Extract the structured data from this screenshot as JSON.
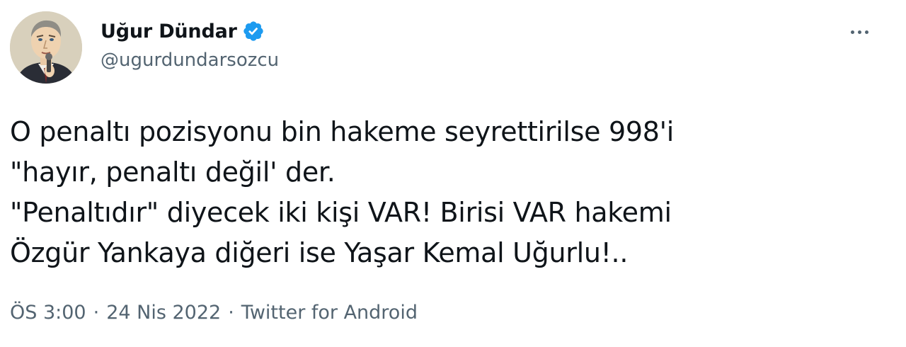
{
  "author": {
    "display_name": "Uğur Dündar",
    "handle": "@ugurdundarsozcu",
    "verified": true,
    "avatar_icon": "profile-portrait-avatar",
    "verified_icon": "verified-badge-icon"
  },
  "more_icon": "more-options-icon",
  "tweet": {
    "lines": [
      "O penaltı pozisyonu bin hakeme seyrettirilse 998'i",
      "\"hayır, penaltı değil' der.",
      "\"Penaltıdır\" diyecek iki kişi VAR! Birisi VAR hakemi",
      "Özgür Yankaya diğeri ise Yaşar Kemal Uğurlu!.."
    ]
  },
  "meta": {
    "time": "ÖS 3:00",
    "separator": "·",
    "date": "24 Nis 2022",
    "source": "Twitter for Android"
  },
  "colors": {
    "text_primary": "#0f1419",
    "text_secondary": "#536471",
    "verified_blue": "#1d9bf0"
  }
}
